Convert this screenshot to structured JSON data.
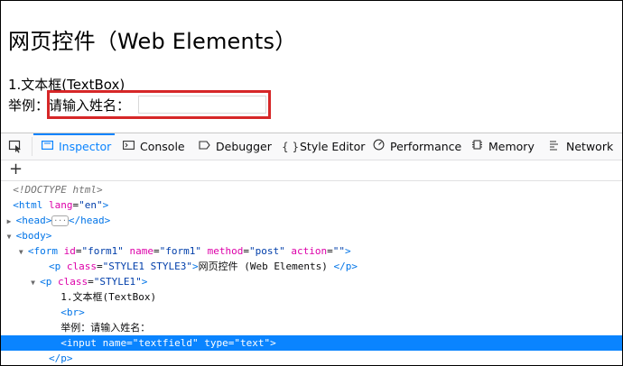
{
  "page": {
    "title": "网页控件（Web Elements）",
    "line1": "1.文本框(TextBox)",
    "line2_prefix": "举例：",
    "line2_label": "请输入姓名：",
    "textfield_value": ""
  },
  "devtools": {
    "tabs": [
      {
        "label": "Inspector",
        "icon": "inspector-icon"
      },
      {
        "label": "Console",
        "icon": "console-icon"
      },
      {
        "label": "Debugger",
        "icon": "debugger-icon"
      },
      {
        "label": "Style Editor",
        "icon": "style-editor-icon"
      },
      {
        "label": "Performance",
        "icon": "performance-icon"
      },
      {
        "label": "Memory",
        "icon": "memory-icon"
      },
      {
        "label": "Network",
        "icon": "network-icon"
      }
    ],
    "active_tab": "Inspector",
    "markup": {
      "doctype": "<!DOCTYPE html>",
      "html_open": "<html",
      "html_attr": "lang",
      "html_val": "\"en\"",
      "head_open": "<head>",
      "head_close": "</head>",
      "body_open": "<body>",
      "form_open": "<form",
      "form_id_attr": "id",
      "form_id_val": "\"form1\"",
      "form_name_attr": "name",
      "form_name_val": "\"form1\"",
      "form_method_attr": "method",
      "form_method_val": "\"post\"",
      "form_action_attr": "action",
      "form_action_val": "\"\"",
      "p1_open": "<p",
      "p1_class_attr": "class",
      "p1_class_val": "\"STYLE1 STYLE3\"",
      "p1_text": "网页控件 (Web Elements) ",
      "p1_close": "</p>",
      "p2_open": "<p",
      "p2_class_attr": "class",
      "p2_class_val": "\"STYLE1\"",
      "text1": "1.文本框(TextBox)",
      "br": "<br>",
      "text2": "举例：请输入姓名：",
      "input_open": "<input",
      "input_name_attr": "name",
      "input_name_val": "\"textfield\"",
      "input_type_attr": "type",
      "input_type_val": "\"text\"",
      "p2_close": "</p>"
    }
  },
  "colors": {
    "highlight_box": "#d62728",
    "accent": "#0a84ff",
    "tag": "#0074e8",
    "attr": "#dd00a9",
    "value": "#003eaa"
  }
}
